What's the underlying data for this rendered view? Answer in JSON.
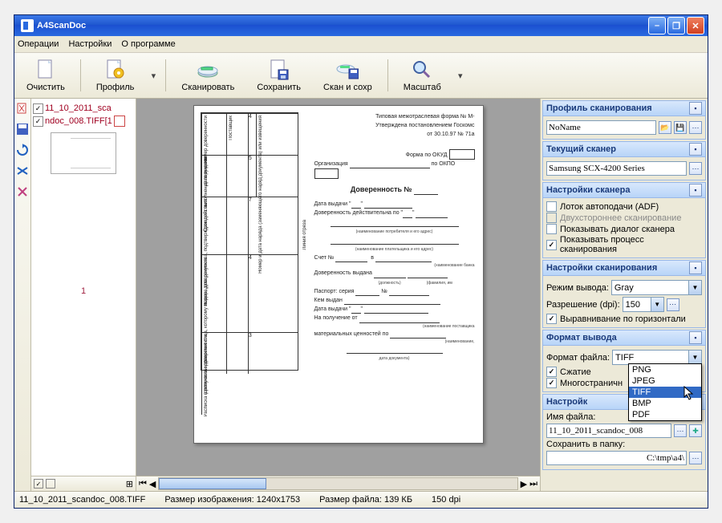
{
  "title": "A4ScanDoc",
  "menu": {
    "ops": "Операции",
    "settings": "Настройки",
    "about": "О программе"
  },
  "toolbar": {
    "clear": "Очистить",
    "profile": "Профиль",
    "scan": "Сканировать",
    "save": "Сохранить",
    "scan_save": "Скан и сохр",
    "zoom": "Масштаб"
  },
  "filelist": {
    "items": [
      {
        "checked": true,
        "name": "11_10_2011_sca"
      },
      {
        "checked": true,
        "name": "ndoc_008.TIFF[1"
      }
    ],
    "page_num": "1"
  },
  "doc": {
    "header_l1": "Типовая межотраслевая форма № М-",
    "header_l2": "Утверждена постановлением Госкомс",
    "header_l3": "от 30.10.97 № 71а",
    "form_okud": "Форма по ОКУД",
    "po_okpo": "по ОКПО",
    "org": "Организация",
    "title": "Доверенность  №",
    "date_issue": "Дата выдачи \"",
    "valid_until": "Доверенность действительна по \"",
    "sm1": "(наименование потребителя и его адрес)",
    "sm2": "(наименование плательщика и его адрес)",
    "account": "Счет №",
    "v": "в",
    "sm3": "(наименование банка",
    "issued": "Доверенность выдана",
    "sm4": "(должность)",
    "sm5": "(фамилия, им",
    "passport": "Паспорт: серия",
    "no": "№",
    "kem": "Кем выдан",
    "date2": "Дата выдачи \"",
    "receive": "На получение от",
    "sm6": "(наименование поставщика",
    "material": "материальных ценностей по",
    "sm7": "(наименование,",
    "sm8": "дата документа)",
    "tbl": {
      "c1": "Номер доверенности",
      "c2": "Дата выдачи",
      "c3": "Срок действия",
      "c4": "Должность и фамилия лица, которому выдана доверенность",
      "c5": "Расписка в получении доверенности",
      "r4": "Поставщик",
      "r7": "Номер и дата наряда (заменяющего наряд документа) или извещения",
      "rn": "Номер, дата документа, подтверждающего выполнение поручения",
      "side": "Линия отреза"
    }
  },
  "panels": {
    "p1": {
      "title": "Профиль сканирования",
      "value": "NoName"
    },
    "p2": {
      "title": "Текущий сканер",
      "value": "Samsung SCX-4200 Series"
    },
    "p3": {
      "title": "Настройки сканера",
      "adr": "Лоток автоподачи (ADF)",
      "duplex": "Двухстороннее сканирование",
      "dialog": "Показывать диалог сканера",
      "process": "Показывать процесс сканирования"
    },
    "p4": {
      "title": "Настройки сканирования",
      "mode_lbl": "Режим вывода:",
      "mode": "Gray",
      "dpi_lbl": "Разрешение (dpi):",
      "dpi": "150",
      "align": "Выравнивание по горизонтали"
    },
    "p5": {
      "title": "Формат вывода",
      "fmt_lbl": "Формат файла:",
      "fmt": "TIFF",
      "compress": "Сжатие",
      "multipage": "Многостраничн",
      "options": [
        "PNG",
        "JPEG",
        "TIFF",
        "BMP",
        "PDF"
      ]
    },
    "p6": {
      "title": "Настройк",
      "name_lbl": "Имя файла:",
      "name": "11_10_2011_scandoc_008",
      "folder_lbl": "Сохранить в папку:",
      "folder": "C:\\tmp\\a4\\"
    }
  },
  "status": {
    "file": "11_10_2011_scandoc_008.TIFF",
    "size_lbl": "Размер изображения: 1240x1753",
    "fsize": "Размер файла: 139 КБ",
    "dpi": "150 dpi"
  }
}
